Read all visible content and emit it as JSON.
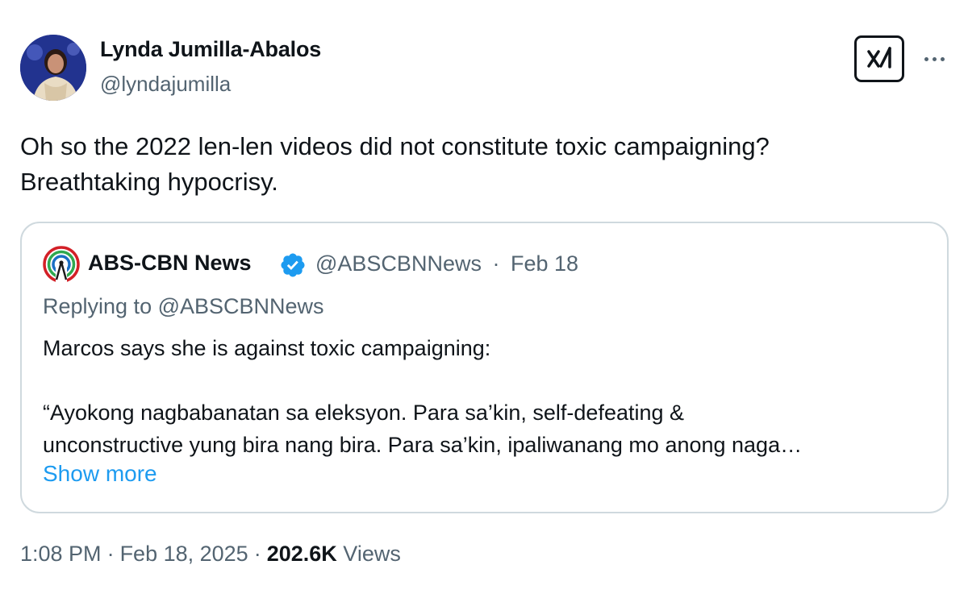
{
  "author": {
    "name": "Lynda Jumilla-Abalos",
    "handle": "@lyndajumilla"
  },
  "tweet": {
    "text_line1": "Oh so the 2022 len-len videos did not constitute toxic campaigning?",
    "text_line2": "Breathtaking hypocrisy."
  },
  "quote": {
    "name": "ABS-CBN News",
    "handle": "@ABSCBNNews",
    "separator": "·",
    "date": "Feb 18",
    "replying_to": "Replying to @ABSCBNNews",
    "line1": "Marcos says she is against toxic campaigning:",
    "line2": "“Ayokong nagbabanatan sa eleksyon. Para sa’kin, self-defeating &",
    "line3": "unconstructive yung bira nang bira. Para sa’kin, ipaliwanang mo anong naga…",
    "show_more": "Show more"
  },
  "footer": {
    "time": "1:08 PM",
    "separator": "·",
    "date": "Feb 18, 2025",
    "views_count": "202.6K",
    "views_label": "Views"
  },
  "icons": {
    "grok": "grok-icon",
    "more": "more-icon",
    "verified": "verified-badge-icon",
    "logo": "abs-cbn-logo-icon"
  },
  "colors": {
    "text": "#0f1419",
    "secondary": "#536471",
    "link": "#1d9bf0",
    "border": "#cfd9de",
    "verified": "#1d9bf0"
  }
}
